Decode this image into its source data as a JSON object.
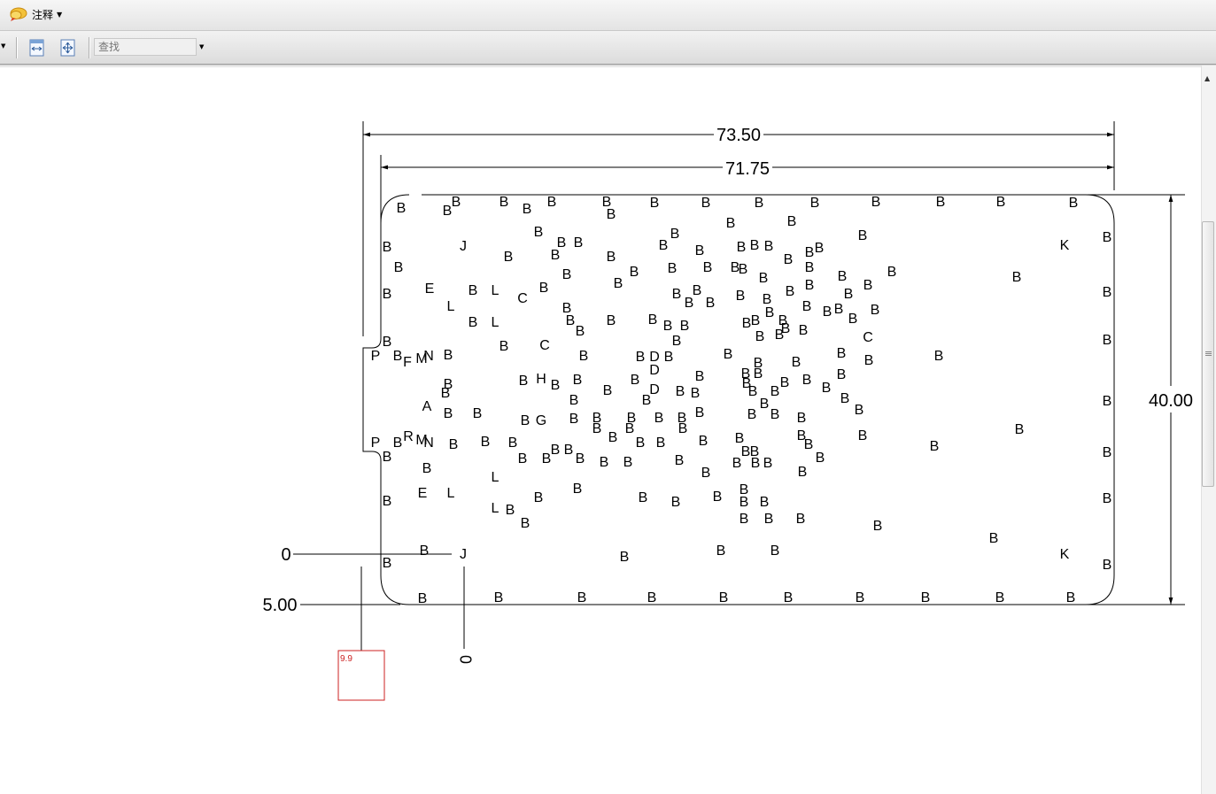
{
  "toolbar": {
    "annotation_menu_label": "注释",
    "search_placeholder": "查找",
    "icons": [
      "annotation-icon",
      "chevron-down-icon",
      "fit-width-icon",
      "fit-page-icon"
    ]
  },
  "drawing": {
    "dimensions": {
      "overall_width": "73.50",
      "inner_width": "71.75",
      "height": "40.00",
      "origin_y": "0",
      "offset": "5.00",
      "origin_x": "0"
    },
    "marker_value": "9.9"
  }
}
